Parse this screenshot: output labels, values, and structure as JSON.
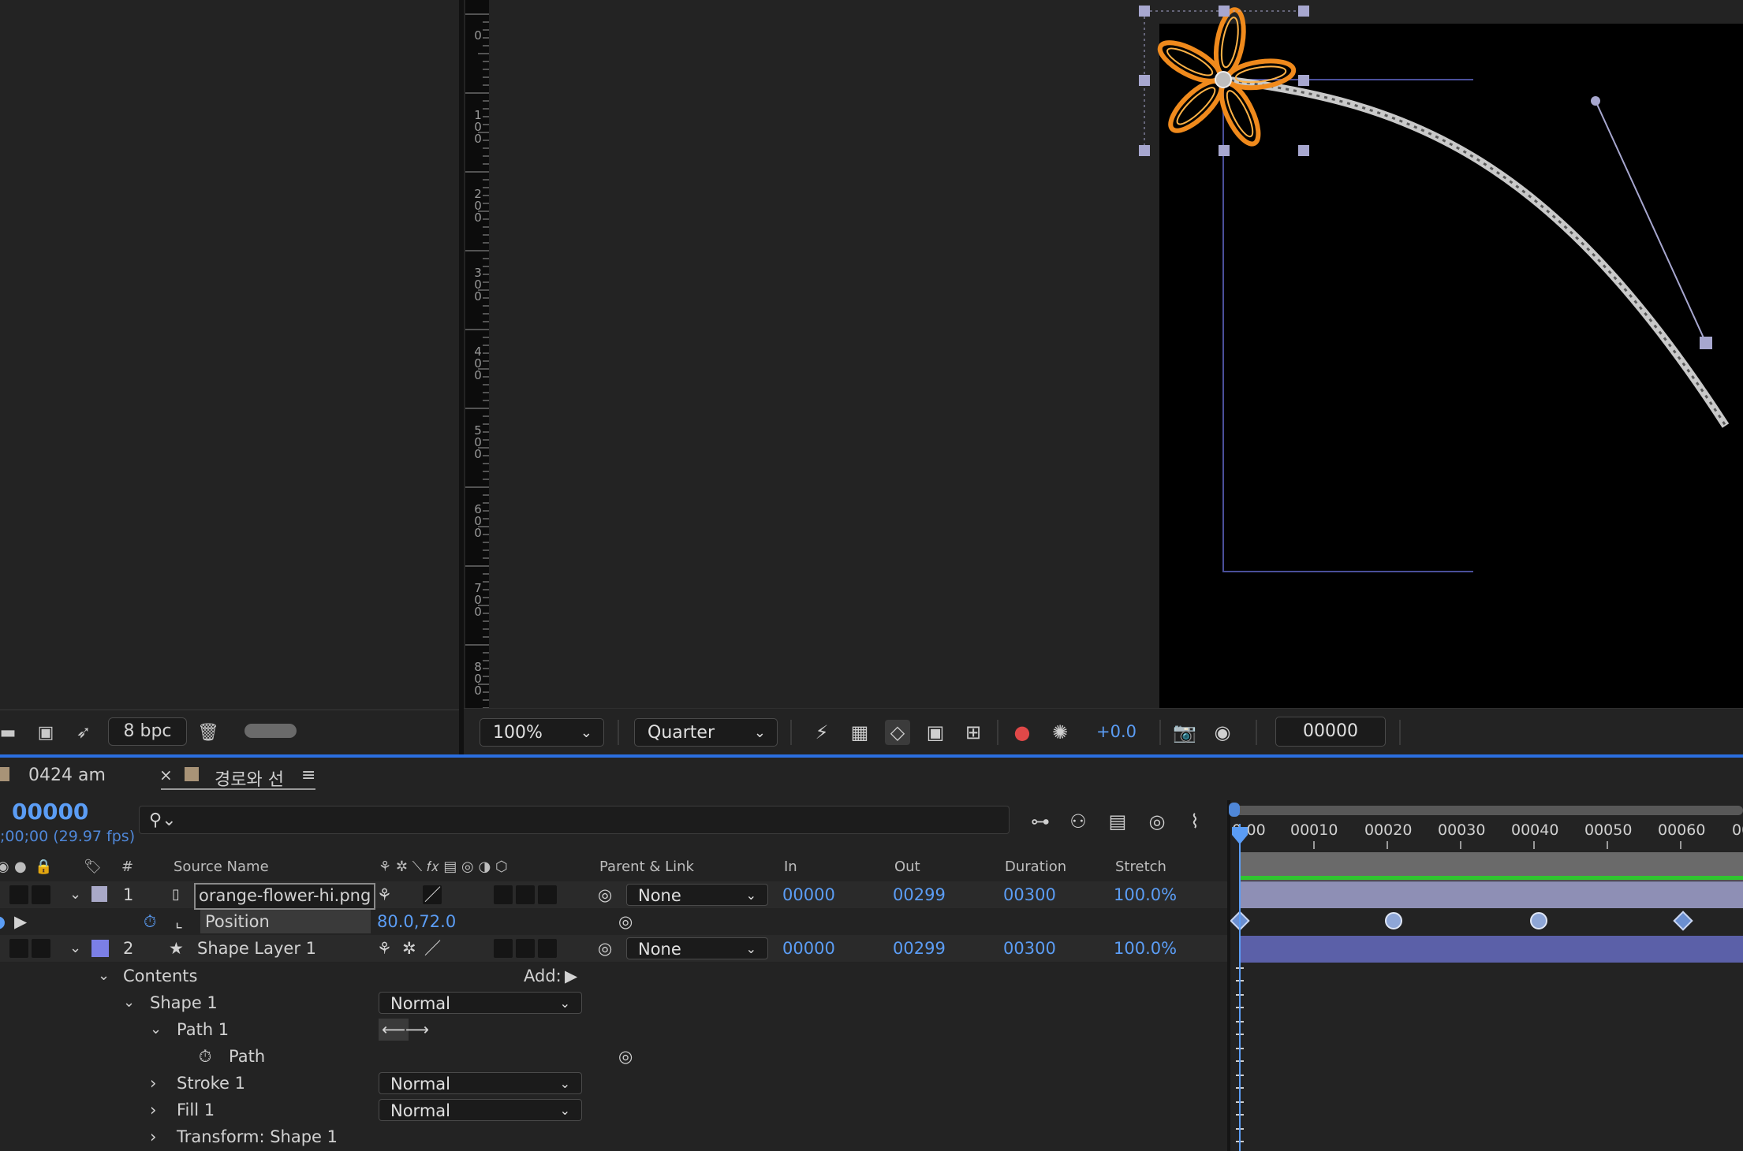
{
  "project_panel": {
    "bpc_label": "8 bpc",
    "icons": [
      "folder-icon",
      "composition-icon",
      "flowchart-icon",
      "trash-icon"
    ]
  },
  "viewer": {
    "ruler_labels": [
      "0",
      "1\n0\n0",
      "2\n0\n0",
      "3\n0\n0",
      "4\n0\n0",
      "5\n0\n0",
      "6\n0\n0",
      "7\n0\n0",
      "8\n0\n0"
    ],
    "zoom": "100%",
    "resolution": "Quarter",
    "exposure": "+0.0",
    "timecode": "00000"
  },
  "timeline": {
    "tabs": [
      {
        "label": "0424 am"
      },
      {
        "label": "경로와 선"
      }
    ],
    "current_time": "00000",
    "fps_info": ";00;00 (29.97 fps)",
    "search_placeholder": "",
    "columns": {
      "number": "#",
      "source_name": "Source Name",
      "parent_link": "Parent & Link",
      "in": "In",
      "out": "Out",
      "duration": "Duration",
      "stretch": "Stretch"
    },
    "layers": [
      {
        "index": "1",
        "name": "orange-flower-hi.png",
        "parent": "None",
        "in": "00000",
        "out": "00299",
        "duration": "00300",
        "stretch": "100.0%",
        "label_color": "#a9a9c8"
      },
      {
        "index": "2",
        "name": "Shape Layer 1",
        "parent": "None",
        "in": "00000",
        "out": "00299",
        "duration": "00300",
        "stretch": "100.0%",
        "label_color": "#7b7fe6"
      }
    ],
    "position": {
      "label": "Position",
      "value": "80.0,72.0"
    },
    "contents": {
      "label": "Contents",
      "add_label": "Add:",
      "shape1": "Shape 1",
      "shape1_mode": "Normal",
      "path1": "Path 1",
      "path": "Path",
      "stroke1": "Stroke 1",
      "stroke1_mode": "Normal",
      "fill1": "Fill 1",
      "fill1_mode": "Normal",
      "transform": "Transform: Shape 1"
    },
    "frame_labels": [
      "0:00",
      "00010",
      "00020",
      "00030",
      "00040",
      "00050",
      "00060",
      "00"
    ]
  },
  "colors": {
    "accent": "#5b9df5",
    "layer1_bar": "#8e8fb5",
    "layer2_bar": "#5b60a8",
    "work_area": "#2fc52f"
  }
}
